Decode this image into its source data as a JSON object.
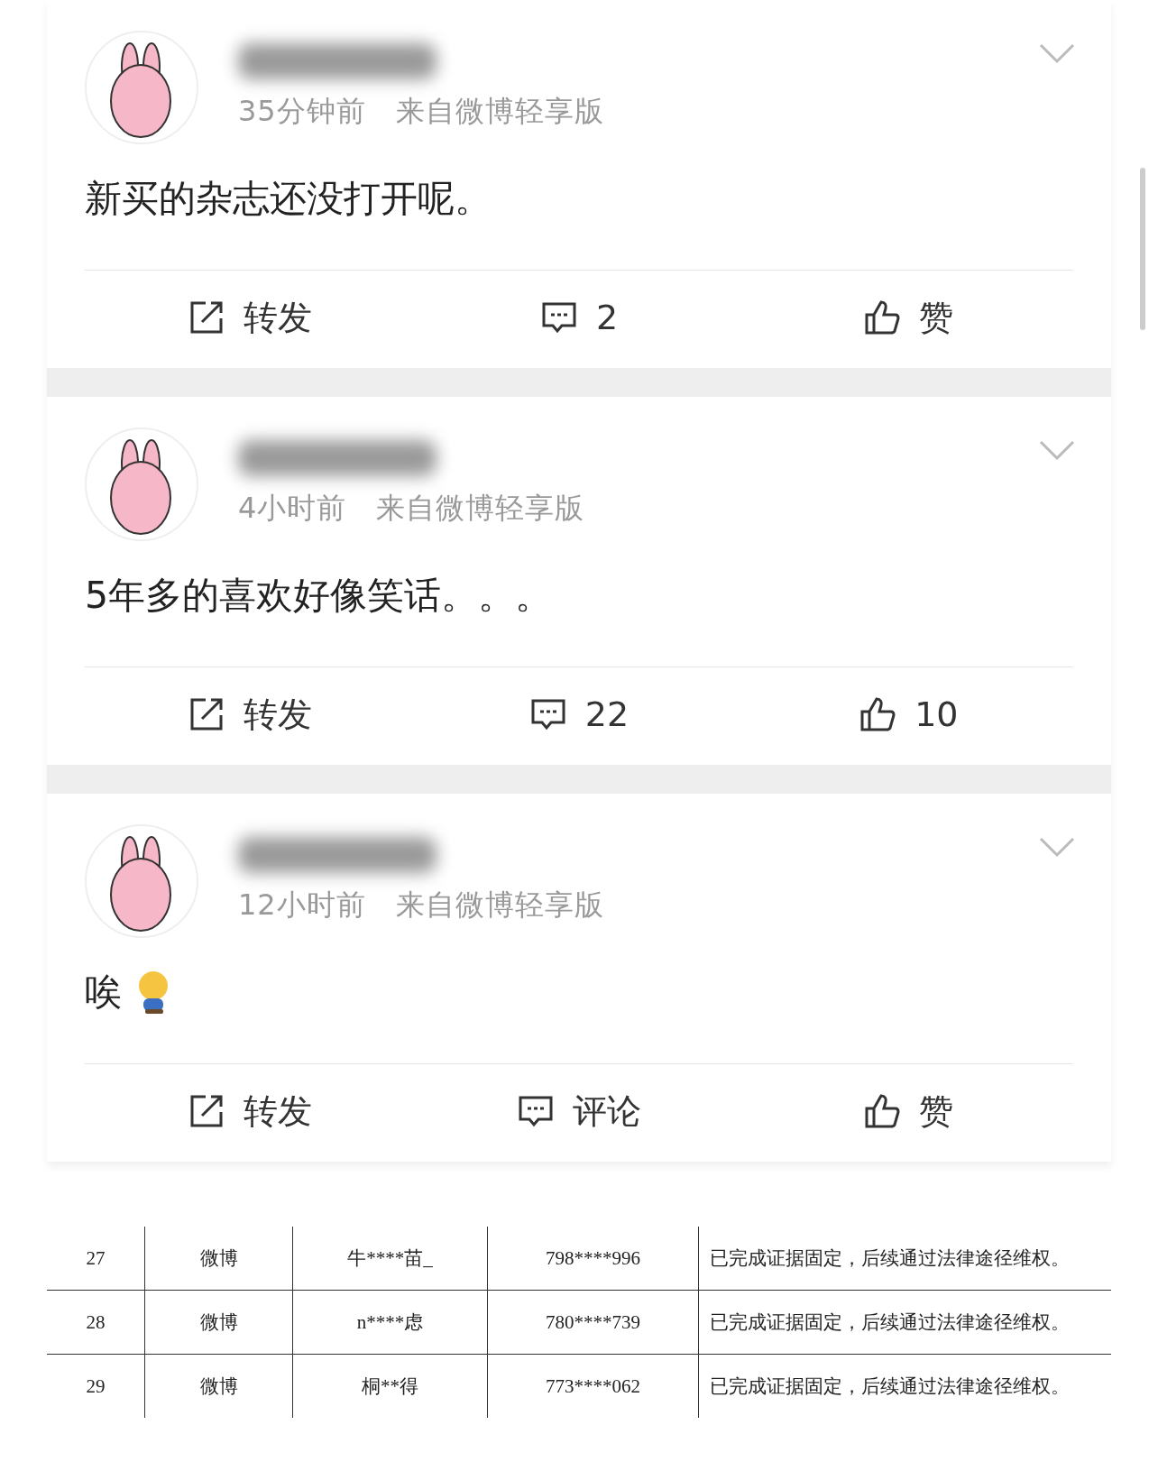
{
  "posts": [
    {
      "time": "35分钟前",
      "source": "来自微博轻享版",
      "text": "新买的杂志还没打开呢。",
      "has_sticker": false,
      "actions": [
        {
          "kind": "repost",
          "label": "转发"
        },
        {
          "kind": "comment",
          "label": "2"
        },
        {
          "kind": "like",
          "label": "赞"
        }
      ]
    },
    {
      "time": "4小时前",
      "source": "来自微博轻享版",
      "text": "5年多的喜欢好像笑话。。。",
      "has_sticker": false,
      "actions": [
        {
          "kind": "repost",
          "label": "转发"
        },
        {
          "kind": "comment",
          "label": "22"
        },
        {
          "kind": "like",
          "label": "10"
        }
      ]
    },
    {
      "time": "12小时前",
      "source": "来自微博轻享版",
      "text": "唉",
      "has_sticker": true,
      "actions": [
        {
          "kind": "repost",
          "label": "转发"
        },
        {
          "kind": "comment",
          "label": "评论"
        },
        {
          "kind": "like",
          "label": "赞"
        }
      ]
    }
  ],
  "table": {
    "rows": [
      [
        "27",
        "微博",
        "牛****苗_",
        "798****996",
        "已完成证据固定，后续通过法律途径维权。"
      ],
      [
        "28",
        "微博",
        "n****虑",
        "780****739",
        "已完成证据固定，后续通过法律途径维权。"
      ],
      [
        "29",
        "微博",
        "桐**得",
        "773****062",
        "已完成证据固定，后续通过法律途径维权。"
      ]
    ]
  }
}
